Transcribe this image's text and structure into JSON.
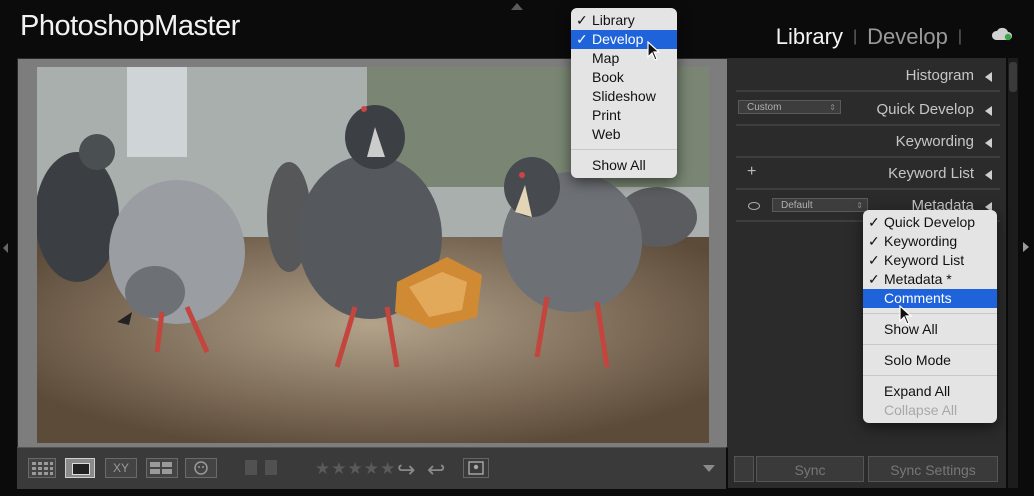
{
  "app": {
    "logo_text": "PhotoshopMaster",
    "modules": {
      "active": "Library",
      "separator": "|",
      "inactive": "Develop",
      "trailing_separator": "|"
    },
    "cloud_icon": "cloud-sync-icon"
  },
  "module_menu": {
    "items": [
      {
        "label": "Library",
        "checked": true,
        "highlighted": false
      },
      {
        "label": "Develop",
        "checked": true,
        "highlighted": true
      },
      {
        "label": "Map",
        "checked": false,
        "highlighted": false
      },
      {
        "label": "Book",
        "checked": false,
        "highlighted": false
      },
      {
        "label": "Slideshow",
        "checked": false,
        "highlighted": false
      },
      {
        "label": "Print",
        "checked": false,
        "highlighted": false
      },
      {
        "label": "Web",
        "checked": false,
        "highlighted": false
      }
    ],
    "show_all": "Show All",
    "check_glyph": "✓"
  },
  "right_panel": {
    "histogram": "Histogram",
    "quick_develop": "Quick Develop",
    "quick_develop_preset": "Custom",
    "keywording": "Keywording",
    "keyword_list": "Keyword List",
    "keyword_list_add": "+",
    "metadata": "Metadata",
    "metadata_preset": "Default",
    "sync": "Sync",
    "sync_settings": "Sync Settings"
  },
  "panel_menu": {
    "items": [
      {
        "label": "Quick Develop",
        "checked": true,
        "highlighted": false
      },
      {
        "label": "Keywording",
        "checked": true,
        "highlighted": false
      },
      {
        "label": "Keyword List",
        "checked": true,
        "highlighted": false
      },
      {
        "label": "Metadata *",
        "checked": true,
        "highlighted": false
      },
      {
        "label": "Comments",
        "checked": false,
        "highlighted": true
      }
    ],
    "show_all": "Show All",
    "solo_mode": "Solo Mode",
    "expand_all": "Expand All",
    "collapse_all": "Collapse All"
  },
  "toolbar": {
    "view_compare_label": "XY",
    "rating_stars": "★★★★★",
    "rotate_left": "↪",
    "rotate_right": "↩"
  },
  "colors": {
    "menu_highlight": "#1f63db",
    "menu_bg": "#e4e4e4",
    "panel_bg": "#2b2b2b"
  }
}
